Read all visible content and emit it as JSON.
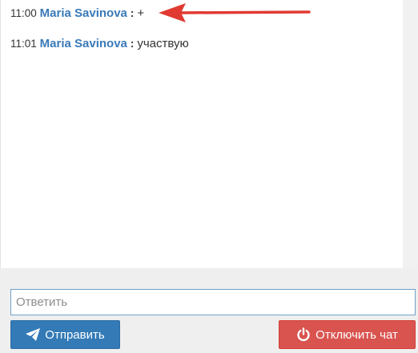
{
  "messages": [
    {
      "time": "11:00",
      "author": "Maria Savinova",
      "separator": ":",
      "text": "+"
    },
    {
      "time": "11:01",
      "author": "Maria Savinova",
      "separator": ":",
      "text": "участвую"
    }
  ],
  "reply": {
    "placeholder": "Ответить",
    "value": ""
  },
  "buttons": {
    "send_label": "Отправить",
    "send_icon": "paper-plane-icon",
    "disconnect_label": "Отключить чат",
    "disconnect_icon": "power-icon"
  },
  "annotation": {
    "arrow_color": "#e03a32",
    "arrow_icon": "arrow-left-icon"
  },
  "colors": {
    "author": "#3a7ab8",
    "send_button": "#337ab7",
    "disconnect_button": "#d9534f",
    "input_border": "#6fa1c9"
  }
}
